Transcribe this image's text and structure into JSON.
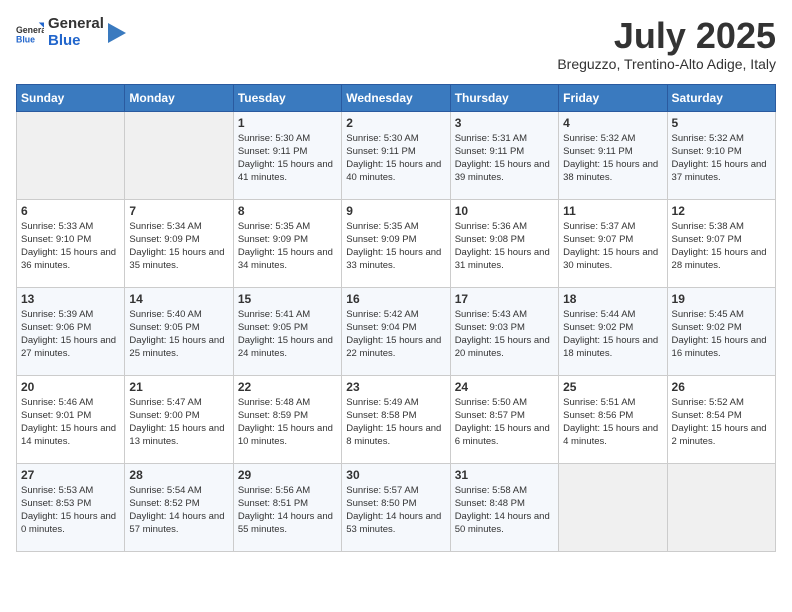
{
  "logo": {
    "general": "General",
    "blue": "Blue"
  },
  "header": {
    "month": "July 2025",
    "location": "Breguzzo, Trentino-Alto Adige, Italy"
  },
  "days_of_week": [
    "Sunday",
    "Monday",
    "Tuesday",
    "Wednesday",
    "Thursday",
    "Friday",
    "Saturday"
  ],
  "weeks": [
    [
      {
        "day": "",
        "sunrise": "",
        "sunset": "",
        "daylight": ""
      },
      {
        "day": "",
        "sunrise": "",
        "sunset": "",
        "daylight": ""
      },
      {
        "day": "1",
        "sunrise": "Sunrise: 5:30 AM",
        "sunset": "Sunset: 9:11 PM",
        "daylight": "Daylight: 15 hours and 41 minutes."
      },
      {
        "day": "2",
        "sunrise": "Sunrise: 5:30 AM",
        "sunset": "Sunset: 9:11 PM",
        "daylight": "Daylight: 15 hours and 40 minutes."
      },
      {
        "day": "3",
        "sunrise": "Sunrise: 5:31 AM",
        "sunset": "Sunset: 9:11 PM",
        "daylight": "Daylight: 15 hours and 39 minutes."
      },
      {
        "day": "4",
        "sunrise": "Sunrise: 5:32 AM",
        "sunset": "Sunset: 9:11 PM",
        "daylight": "Daylight: 15 hours and 38 minutes."
      },
      {
        "day": "5",
        "sunrise": "Sunrise: 5:32 AM",
        "sunset": "Sunset: 9:10 PM",
        "daylight": "Daylight: 15 hours and 37 minutes."
      }
    ],
    [
      {
        "day": "6",
        "sunrise": "Sunrise: 5:33 AM",
        "sunset": "Sunset: 9:10 PM",
        "daylight": "Daylight: 15 hours and 36 minutes."
      },
      {
        "day": "7",
        "sunrise": "Sunrise: 5:34 AM",
        "sunset": "Sunset: 9:09 PM",
        "daylight": "Daylight: 15 hours and 35 minutes."
      },
      {
        "day": "8",
        "sunrise": "Sunrise: 5:35 AM",
        "sunset": "Sunset: 9:09 PM",
        "daylight": "Daylight: 15 hours and 34 minutes."
      },
      {
        "day": "9",
        "sunrise": "Sunrise: 5:35 AM",
        "sunset": "Sunset: 9:09 PM",
        "daylight": "Daylight: 15 hours and 33 minutes."
      },
      {
        "day": "10",
        "sunrise": "Sunrise: 5:36 AM",
        "sunset": "Sunset: 9:08 PM",
        "daylight": "Daylight: 15 hours and 31 minutes."
      },
      {
        "day": "11",
        "sunrise": "Sunrise: 5:37 AM",
        "sunset": "Sunset: 9:07 PM",
        "daylight": "Daylight: 15 hours and 30 minutes."
      },
      {
        "day": "12",
        "sunrise": "Sunrise: 5:38 AM",
        "sunset": "Sunset: 9:07 PM",
        "daylight": "Daylight: 15 hours and 28 minutes."
      }
    ],
    [
      {
        "day": "13",
        "sunrise": "Sunrise: 5:39 AM",
        "sunset": "Sunset: 9:06 PM",
        "daylight": "Daylight: 15 hours and 27 minutes."
      },
      {
        "day": "14",
        "sunrise": "Sunrise: 5:40 AM",
        "sunset": "Sunset: 9:05 PM",
        "daylight": "Daylight: 15 hours and 25 minutes."
      },
      {
        "day": "15",
        "sunrise": "Sunrise: 5:41 AM",
        "sunset": "Sunset: 9:05 PM",
        "daylight": "Daylight: 15 hours and 24 minutes."
      },
      {
        "day": "16",
        "sunrise": "Sunrise: 5:42 AM",
        "sunset": "Sunset: 9:04 PM",
        "daylight": "Daylight: 15 hours and 22 minutes."
      },
      {
        "day": "17",
        "sunrise": "Sunrise: 5:43 AM",
        "sunset": "Sunset: 9:03 PM",
        "daylight": "Daylight: 15 hours and 20 minutes."
      },
      {
        "day": "18",
        "sunrise": "Sunrise: 5:44 AM",
        "sunset": "Sunset: 9:02 PM",
        "daylight": "Daylight: 15 hours and 18 minutes."
      },
      {
        "day": "19",
        "sunrise": "Sunrise: 5:45 AM",
        "sunset": "Sunset: 9:02 PM",
        "daylight": "Daylight: 15 hours and 16 minutes."
      }
    ],
    [
      {
        "day": "20",
        "sunrise": "Sunrise: 5:46 AM",
        "sunset": "Sunset: 9:01 PM",
        "daylight": "Daylight: 15 hours and 14 minutes."
      },
      {
        "day": "21",
        "sunrise": "Sunrise: 5:47 AM",
        "sunset": "Sunset: 9:00 PM",
        "daylight": "Daylight: 15 hours and 13 minutes."
      },
      {
        "day": "22",
        "sunrise": "Sunrise: 5:48 AM",
        "sunset": "Sunset: 8:59 PM",
        "daylight": "Daylight: 15 hours and 10 minutes."
      },
      {
        "day": "23",
        "sunrise": "Sunrise: 5:49 AM",
        "sunset": "Sunset: 8:58 PM",
        "daylight": "Daylight: 15 hours and 8 minutes."
      },
      {
        "day": "24",
        "sunrise": "Sunrise: 5:50 AM",
        "sunset": "Sunset: 8:57 PM",
        "daylight": "Daylight: 15 hours and 6 minutes."
      },
      {
        "day": "25",
        "sunrise": "Sunrise: 5:51 AM",
        "sunset": "Sunset: 8:56 PM",
        "daylight": "Daylight: 15 hours and 4 minutes."
      },
      {
        "day": "26",
        "sunrise": "Sunrise: 5:52 AM",
        "sunset": "Sunset: 8:54 PM",
        "daylight": "Daylight: 15 hours and 2 minutes."
      }
    ],
    [
      {
        "day": "27",
        "sunrise": "Sunrise: 5:53 AM",
        "sunset": "Sunset: 8:53 PM",
        "daylight": "Daylight: 15 hours and 0 minutes."
      },
      {
        "day": "28",
        "sunrise": "Sunrise: 5:54 AM",
        "sunset": "Sunset: 8:52 PM",
        "daylight": "Daylight: 14 hours and 57 minutes."
      },
      {
        "day": "29",
        "sunrise": "Sunrise: 5:56 AM",
        "sunset": "Sunset: 8:51 PM",
        "daylight": "Daylight: 14 hours and 55 minutes."
      },
      {
        "day": "30",
        "sunrise": "Sunrise: 5:57 AM",
        "sunset": "Sunset: 8:50 PM",
        "daylight": "Daylight: 14 hours and 53 minutes."
      },
      {
        "day": "31",
        "sunrise": "Sunrise: 5:58 AM",
        "sunset": "Sunset: 8:48 PM",
        "daylight": "Daylight: 14 hours and 50 minutes."
      },
      {
        "day": "",
        "sunrise": "",
        "sunset": "",
        "daylight": ""
      },
      {
        "day": "",
        "sunrise": "",
        "sunset": "",
        "daylight": ""
      }
    ]
  ]
}
